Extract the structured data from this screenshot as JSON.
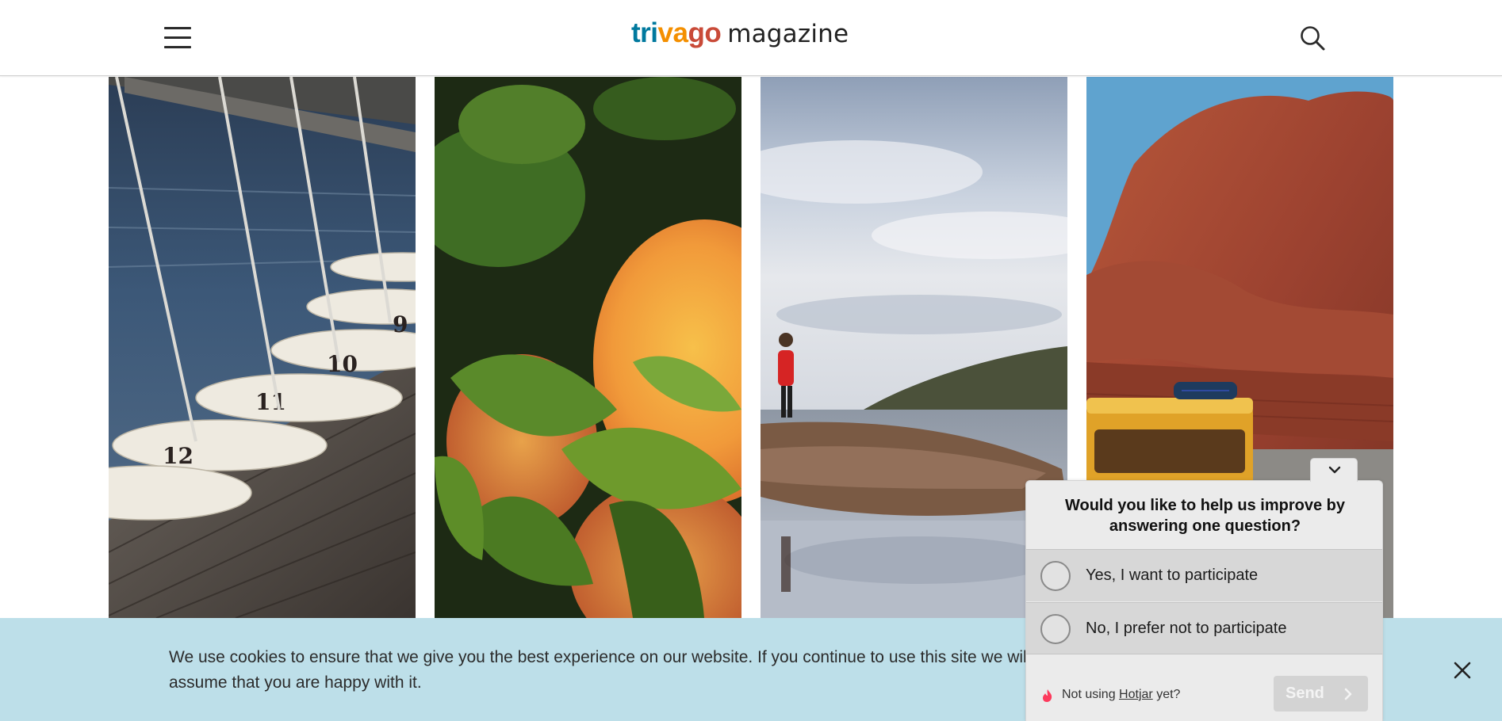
{
  "header": {
    "logo": {
      "tri": "tri",
      "va": "va",
      "go": "go",
      "magazine": "magazine"
    }
  },
  "cookie_bar": {
    "text": "We use cookies to ensure that we give you the best experience on our website. If you continue to use this site we will assume that you are happy with it."
  },
  "survey": {
    "question": "Would you like to help us improve by answering one question?",
    "options": [
      {
        "label": "Yes, I want to participate"
      },
      {
        "label": "No, I prefer not to participate"
      }
    ],
    "footer": {
      "prefix": "Not using",
      "link": "Hotjar",
      "suffix": "yet?"
    },
    "send_label": "Send"
  },
  "colors": {
    "logo_blue": "#00799e",
    "logo_orange": "#f48f00",
    "logo_red": "#c94a38",
    "cookie_bg": "#bddfe9"
  },
  "icons": {
    "menu": "hamburger-menu-icon",
    "search": "search-icon",
    "close": "close-icon",
    "collapse": "chevron-down-icon",
    "hotjar": "hotjar-flame-icon",
    "send": "chevron-right-icon"
  }
}
